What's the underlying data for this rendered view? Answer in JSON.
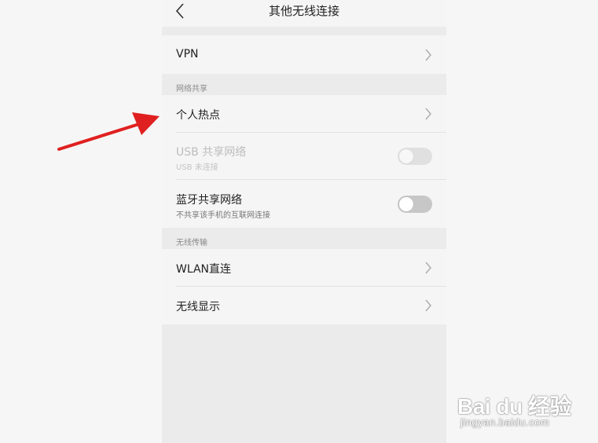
{
  "header": {
    "title": "其他无线连接",
    "back_icon": "chevron-left-icon"
  },
  "rows": {
    "vpn": {
      "label": "VPN",
      "icon": "chevron-right-icon"
    },
    "hotspot": {
      "label": "个人热点",
      "icon": "chevron-right-icon"
    },
    "usb": {
      "label": "USB 共享网络",
      "sub": "USB 未连接",
      "enabled": false,
      "on": false
    },
    "bluetooth": {
      "label": "蓝牙共享网络",
      "sub": "不共享该手机的互联网连接",
      "enabled": true,
      "on": false
    },
    "wlan_direct": {
      "label": "WLAN直连",
      "icon": "chevron-right-icon"
    },
    "wireless_display": {
      "label": "无线显示",
      "icon": "chevron-right-icon"
    }
  },
  "sections": {
    "tethering": "网络共享",
    "wireless_transfer": "无线传输"
  },
  "annotation": {
    "arrow_color": "#e02020",
    "points_to": "个人热点"
  },
  "watermark": {
    "brand": "Bai du 经验",
    "url": "jingyan.baidu.com"
  },
  "colors": {
    "row_bg": "#f5f5f5",
    "section_bg": "#ebebeb",
    "toggle_off": "#c7c7c7"
  }
}
